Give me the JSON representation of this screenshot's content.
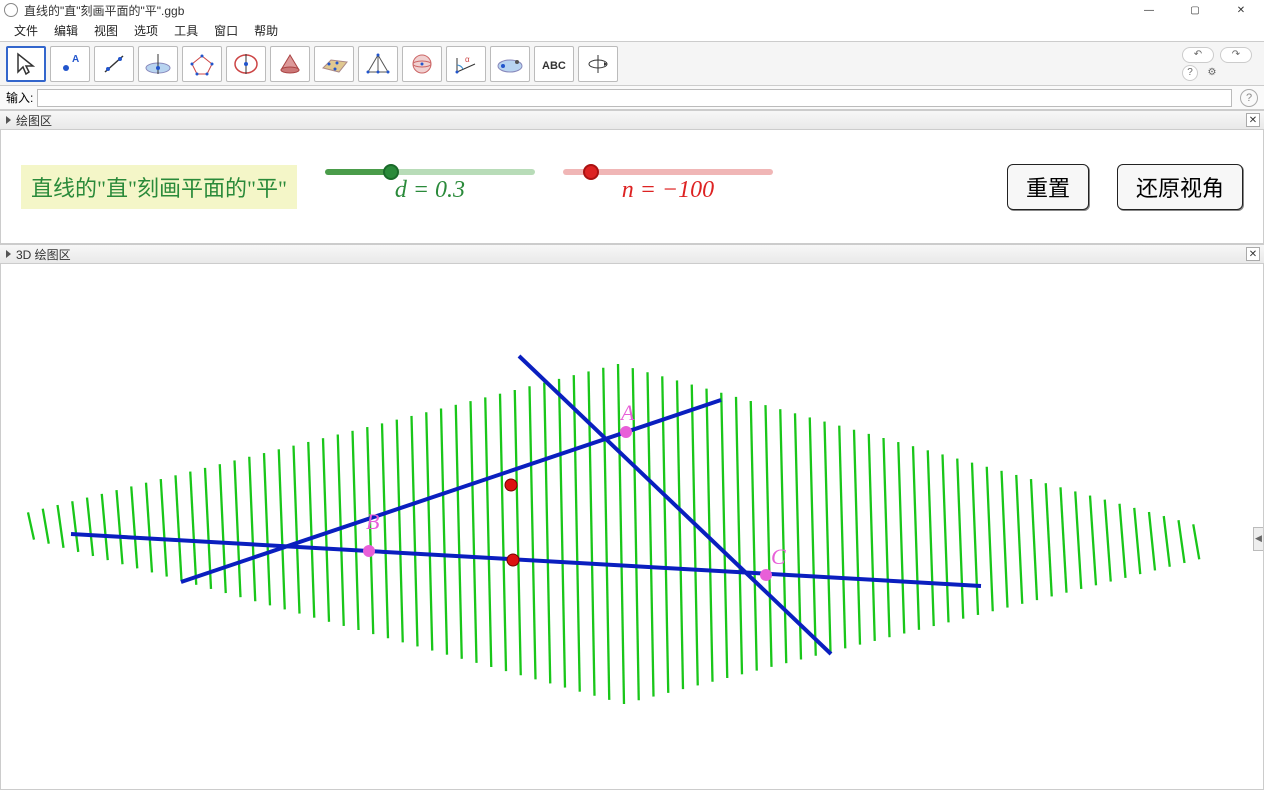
{
  "window": {
    "title": "直线的\"直\"刻画平面的\"平\".ggb",
    "controls": {
      "minimize": "—",
      "maximize": "▢",
      "close": "✕"
    }
  },
  "menu": [
    "文件",
    "编辑",
    "视图",
    "选项",
    "工具",
    "窗口",
    "帮助"
  ],
  "toolbar": {
    "tools": [
      "move",
      "point",
      "line",
      "perp",
      "circle",
      "cone",
      "plane",
      "pyramid",
      "sphere",
      "angle",
      "reflect",
      "text",
      "rotate-view"
    ],
    "undo": "↶",
    "redo": "↷",
    "help": "?",
    "settings": "⚙"
  },
  "input": {
    "label": "输入:",
    "value": "",
    "help": "?"
  },
  "panels": {
    "graphics": {
      "title": "绘图区",
      "close": "✕"
    },
    "graphics3d": {
      "title": "3D 绘图区",
      "close": "✕"
    }
  },
  "content": {
    "heading": "直线的\"直\"刻画平面的\"平\"",
    "slider_d": {
      "var": "d",
      "value": 0.3,
      "display": "d = 0.3"
    },
    "slider_n": {
      "var": "n",
      "value": -100,
      "display": "n = −100"
    },
    "button_reset": "重置",
    "button_restore": "还原视角"
  },
  "scene3d": {
    "points": {
      "A": "A",
      "B": "B",
      "C": "C"
    },
    "colors": {
      "plane_lines": "#19c619",
      "blue_lines": "#0a1fbf",
      "point_pink": "#e85fd8",
      "point_red": "#d11"
    }
  }
}
